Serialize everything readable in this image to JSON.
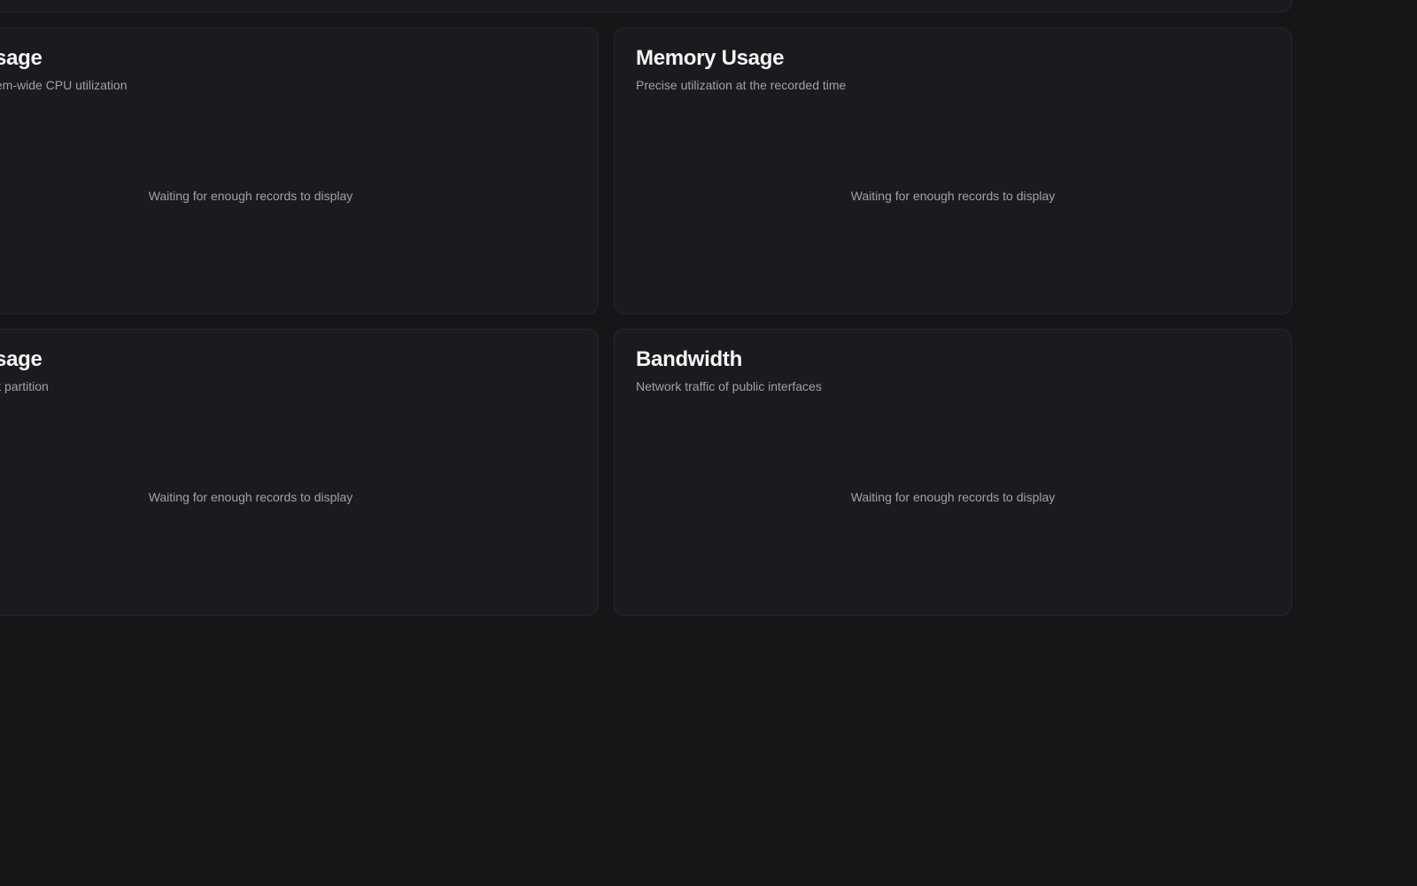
{
  "cards": {
    "cpu": {
      "title": "Usage",
      "subtitle": "ystem-wide CPU utilization",
      "empty_message": "Waiting for enough records to display"
    },
    "memory": {
      "title": "Memory Usage",
      "subtitle": "Precise utilization at the recorded time",
      "empty_message": "Waiting for enough records to display"
    },
    "disk": {
      "title": "Usage",
      "subtitle": "root partition",
      "empty_message": "Waiting for enough records to display"
    },
    "bandwidth": {
      "title": "Bandwidth",
      "subtitle": "Network traffic of public interfaces",
      "empty_message": "Waiting for enough records to display"
    }
  },
  "colors": {
    "page_background": "#151618",
    "card_background": "#1a1b1e",
    "card_border": "#25262a",
    "title_text": "#f4f4f5",
    "muted_text": "#a1a1aa"
  }
}
